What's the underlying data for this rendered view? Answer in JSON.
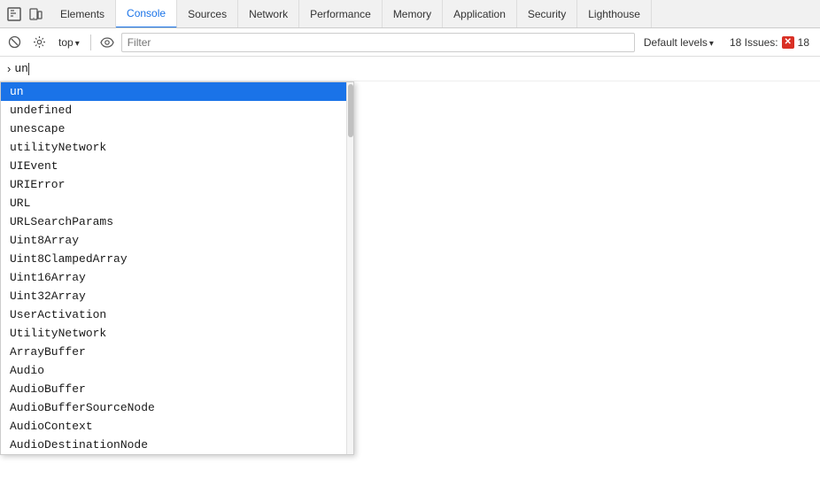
{
  "tabs": [
    {
      "id": "elements",
      "label": "Elements",
      "active": false
    },
    {
      "id": "console",
      "label": "Console",
      "active": true
    },
    {
      "id": "sources",
      "label": "Sources",
      "active": false
    },
    {
      "id": "network",
      "label": "Network",
      "active": false
    },
    {
      "id": "performance",
      "label": "Performance",
      "active": false
    },
    {
      "id": "memory",
      "label": "Memory",
      "active": false
    },
    {
      "id": "application",
      "label": "Application",
      "active": false
    },
    {
      "id": "security",
      "label": "Security",
      "active": false
    },
    {
      "id": "lighthouse",
      "label": "Lighthouse",
      "active": false
    }
  ],
  "toolbar": {
    "context_label": "top",
    "filter_placeholder": "Filter",
    "filter_value": "",
    "levels_label": "Default levels",
    "issues_label": "18 Issues:",
    "issues_count": "18"
  },
  "console": {
    "prompt": "›",
    "input_text": "un"
  },
  "autocomplete": {
    "items": [
      {
        "text": "un",
        "selected": true
      },
      {
        "text": "undefined",
        "selected": false
      },
      {
        "text": "unescape",
        "selected": false
      },
      {
        "text": "utilityNetwork",
        "selected": false
      },
      {
        "text": "UIEvent",
        "selected": false
      },
      {
        "text": "URIError",
        "selected": false
      },
      {
        "text": "URL",
        "selected": false
      },
      {
        "text": "URLSearchParams",
        "selected": false
      },
      {
        "text": "Uint8Array",
        "selected": false
      },
      {
        "text": "Uint8ClampedArray",
        "selected": false
      },
      {
        "text": "Uint16Array",
        "selected": false
      },
      {
        "text": "Uint32Array",
        "selected": false
      },
      {
        "text": "UserActivation",
        "selected": false
      },
      {
        "text": "UtilityNetwork",
        "selected": false
      },
      {
        "text": "ArrayBuffer",
        "selected": false
      },
      {
        "text": "Audio",
        "selected": false
      },
      {
        "text": "AudioBuffer",
        "selected": false
      },
      {
        "text": "AudioBufferSourceNode",
        "selected": false
      },
      {
        "text": "AudioContext",
        "selected": false
      },
      {
        "text": "AudioDestinationNode",
        "selected": false
      }
    ]
  }
}
